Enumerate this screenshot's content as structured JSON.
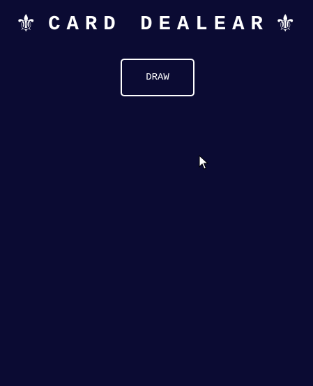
{
  "header": {
    "title": "CARD DEALEAR",
    "left_ornament": "⚜",
    "right_ornament": "⚜",
    "ornament_icon": "fleur-de-lis-icon"
  },
  "controls": {
    "draw_label": "DRAW"
  },
  "colors": {
    "background": "#0b0b33",
    "foreground": "#ffffff"
  }
}
